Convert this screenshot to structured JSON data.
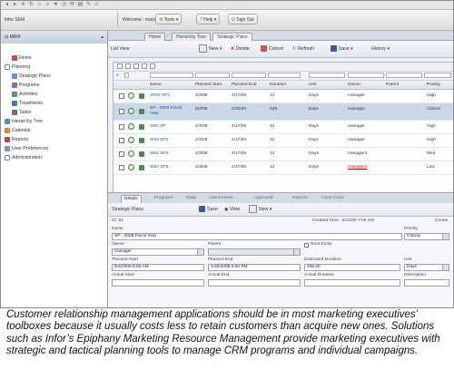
{
  "toolbar": {
    "app_label": "Infor SEM",
    "user_label": "Welcome : manager",
    "tools_label": "Tools",
    "help_label": "Help",
    "signout_label": "Sign Out"
  },
  "sidebar": {
    "header": "MRM",
    "items": [
      {
        "label": "Home",
        "icon": "home-icon"
      },
      {
        "label": "Planning",
        "icon": "folder-icon"
      },
      {
        "label": "Strategic Plans",
        "icon": "plan-icon"
      },
      {
        "label": "Programs",
        "icon": "program-icon"
      },
      {
        "label": "Activities",
        "icon": "activity-icon"
      },
      {
        "label": "Treatments",
        "icon": "treatment-icon"
      },
      {
        "label": "Tasks",
        "icon": "task-icon"
      },
      {
        "label": "Hierarchy Tree",
        "icon": "tree-icon"
      },
      {
        "label": "Calendar",
        "icon": "calendar-icon"
      },
      {
        "label": "Reports",
        "icon": "report-icon"
      },
      {
        "label": "User Preferences",
        "icon": "prefs-icon"
      },
      {
        "label": "Administration",
        "icon": "admin-icon"
      }
    ]
  },
  "main": {
    "tabs": [
      "Home",
      "Hierarchy Tree",
      "Strategic Plans"
    ],
    "list_view_label": "List View",
    "list_actions": [
      "New",
      "Delete",
      "Cancel",
      "Refresh",
      "Save",
      "History"
    ]
  },
  "grid": {
    "columns": [
      "Name",
      "Planned Start",
      "Planned End",
      "Duration",
      "Unit",
      "Owner",
      "Parent",
      "Priority"
    ],
    "rows": [
      {
        "name": "SP02 SP1",
        "start": "4/3/08",
        "end": "4/17/08",
        "duration": "12",
        "unit": "Days",
        "owner": "manager",
        "parent": "",
        "priority": "High"
      },
      {
        "name": "SP - 2008 Fiscal Year",
        "start": "5/2/08",
        "end": "4/30/09",
        "duration": "239",
        "unit": "Days",
        "owner": "manager",
        "parent": "",
        "priority": "Critical"
      },
      {
        "name": "SI02 SP",
        "start": "4/3/08",
        "end": "4/17/08",
        "duration": "12",
        "unit": "Days",
        "owner": "manager",
        "parent": "",
        "priority": "High"
      },
      {
        "name": "SI02 SP2",
        "start": "4/3/08",
        "end": "4/17/08",
        "duration": "12",
        "unit": "Days",
        "owner": "manager",
        "parent": "",
        "priority": "High"
      },
      {
        "name": "SI02 SP4",
        "start": "4/3/08",
        "end": "4/17/08",
        "duration": "12",
        "unit": "Days",
        "owner": "manager1",
        "parent": "",
        "priority": "Med"
      },
      {
        "name": "SI02 SP5",
        "start": "4/3/08",
        "end": "4/17/08",
        "duration": "12",
        "unit": "Days",
        "owner": "manager2",
        "parent": "",
        "priority": "Low"
      }
    ],
    "close_label": "Close"
  },
  "details": {
    "tabs": [
      "Details",
      "Programs",
      "Tasks",
      "Attachments",
      "Approvals",
      "Reports",
      "Gantt Chart"
    ],
    "section_label": "Strategic Plans",
    "actions": [
      "Save",
      "View",
      "New"
    ],
    "id_label": "ID: 81",
    "created_time": "Created Time : 5/12/05 7:02 AM",
    "created_by": "Create",
    "name_label": "Name",
    "name_value": "SP - 2008 Fiscal Year",
    "priority_label": "Priority",
    "priority_value": "Critical",
    "owner_label": "Owner",
    "owner_value": "manager",
    "parent_label": "Parent",
    "root_entity_label": "Root Entity",
    "planned_start_label": "Planned Start",
    "planned_start_value": "5/2/2008 8:00 AM",
    "planned_end_label": "Planned End",
    "planned_end_value": "4/30/2009 5:00 PM",
    "estimated_duration_label": "Estimated Duration",
    "estimated_duration_value": "239.00",
    "unit_label": "Unit",
    "unit_value": "Days",
    "actual_start_label": "Actual Start",
    "actual_end_label": "Actual End",
    "actual_duration_label": "Actual Duration",
    "description_label": "Description"
  },
  "caption": "Customer relationship management applications should be in most marketing executives’ toolboxes because it usually costs less to retain customers than acquire new ones. Solutions such as Infor’s Epiphany Marketing Resource Management provide marketing executives with strategic and tactical planning tools to manage CRM programs and individual campaigns.",
  "colors": {
    "accent": "#1a4fa0",
    "selected_row": "#c9d7e8",
    "panel_bg": "#eef1f5",
    "link_red": "#c00000"
  }
}
